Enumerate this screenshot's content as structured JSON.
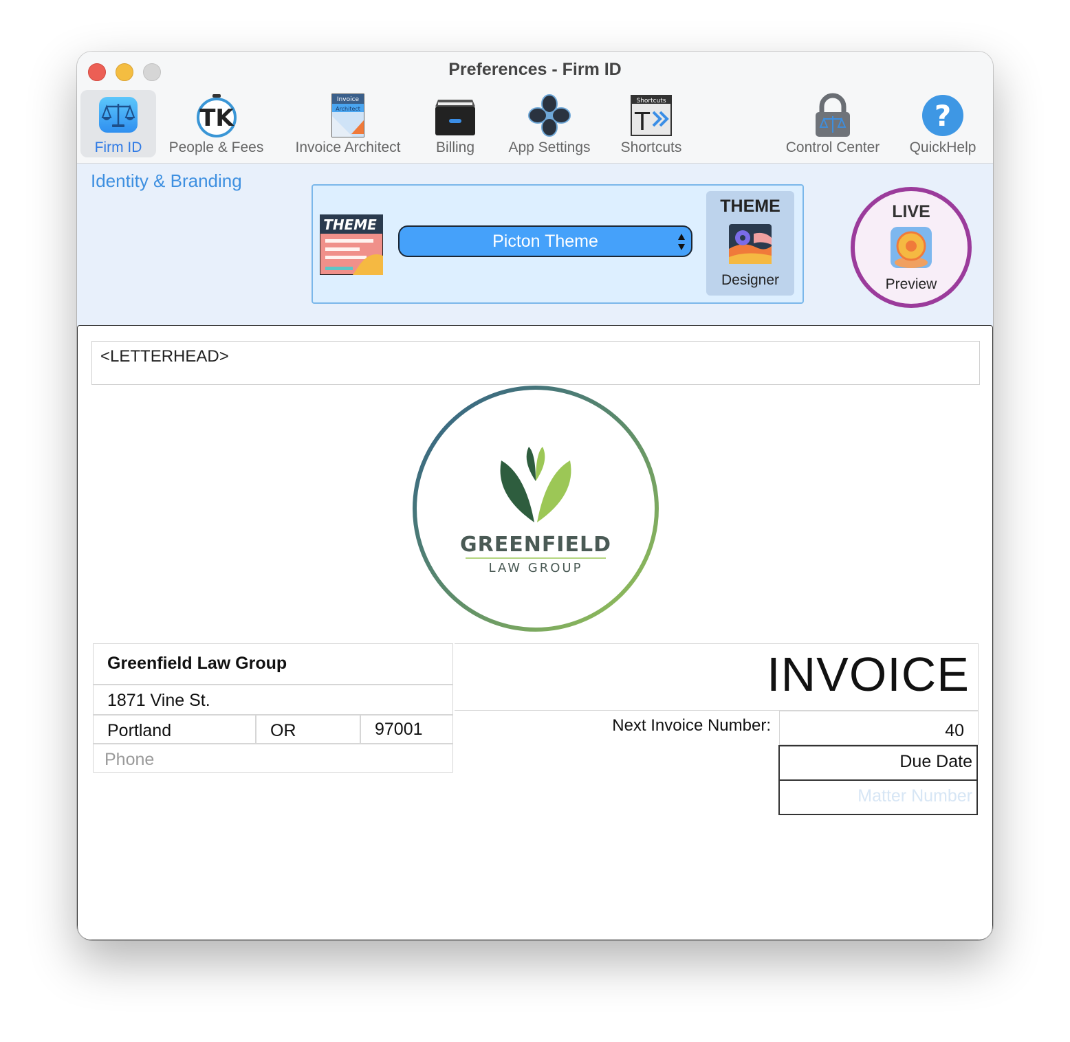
{
  "window": {
    "title": "Preferences - Firm ID"
  },
  "toolbar": {
    "items": [
      {
        "label": "Firm ID",
        "icon": "scales-icon",
        "active": true
      },
      {
        "label": "People & Fees",
        "icon": "timekeeper-icon"
      },
      {
        "label": "Invoice Architect",
        "icon": "invoice-architect-icon"
      },
      {
        "label": "Billing",
        "icon": "billing-drawer-icon"
      },
      {
        "label": "App Settings",
        "icon": "flower-icon"
      },
      {
        "label": "Shortcuts",
        "icon": "shortcuts-icon"
      },
      {
        "label": "Control Center",
        "icon": "lock-icon"
      },
      {
        "label": "QuickHelp",
        "icon": "question-icon"
      }
    ],
    "mini_text": {
      "invoice_top": "Invoice",
      "invoice_sub": "Architect",
      "shortcuts": "Shortcuts"
    }
  },
  "identity": {
    "section_title": "Identity & Branding",
    "theme_badge": "THEME",
    "theme_select": "Picton Theme",
    "designer_top": "THEME",
    "designer_bottom": "Designer",
    "live_top": "LIVE",
    "live_bottom": "Preview"
  },
  "document": {
    "letterhead": "<LETTERHEAD>",
    "logo": {
      "name": "GREENFIELD",
      "sub": "LAW GROUP"
    },
    "firm_name": "Greenfield Law Group",
    "street": "1871 Vine St.",
    "city": "Portland",
    "state": "OR",
    "zip": "97001",
    "phone_placeholder": "Phone",
    "invoice_title": "INVOICE",
    "next_invoice_label": "Next Invoice Number:",
    "next_invoice_value": "40",
    "due_date": "Due Date",
    "matter_placeholder": "Matter Number"
  },
  "colors": {
    "accent": "#2f7ae5",
    "select_blue": "#45a1fa",
    "live_ring": "#9b3b9b",
    "logo_dark_green": "#2e5d3e",
    "logo_light_green": "#9cc756"
  }
}
